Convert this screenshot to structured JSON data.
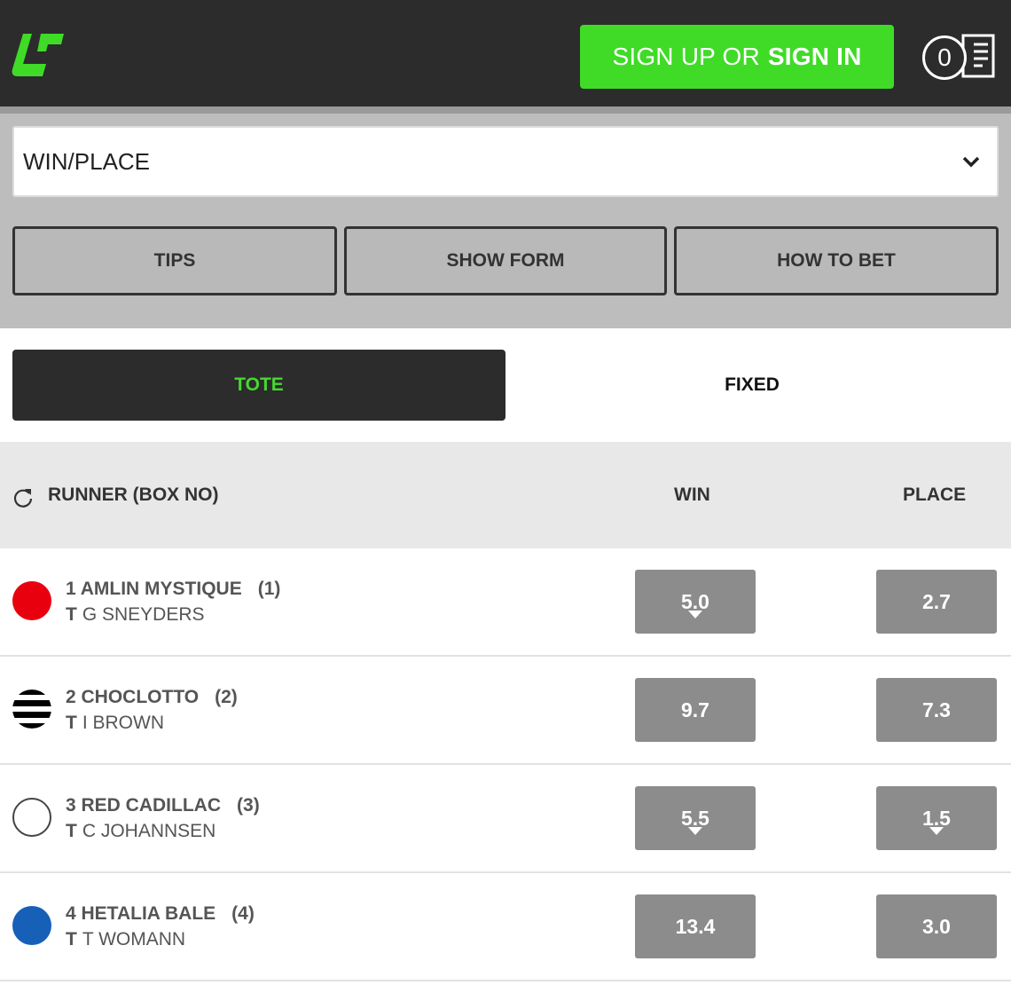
{
  "header": {
    "signin_label_regular": "SIGN UP OR",
    "signin_label_bold": "SIGN IN",
    "betslip_count": "0",
    "logo_icon": "ub-logo-icon",
    "betslip_icon": "betslip-icon",
    "brand_color": "#3fdb27"
  },
  "bet_type": {
    "selected": "WIN/PLACE",
    "icon": "chevron-down-icon"
  },
  "action_tabs": [
    "TIPS",
    "SHOW FORM",
    "HOW TO BET"
  ],
  "price_type": {
    "options": [
      "TOTE",
      "FIXED"
    ],
    "active": "TOTE"
  },
  "table": {
    "refresh_icon": "refresh-icon",
    "headers": {
      "runner": "RUNNER (BOX NO)",
      "win": "WIN",
      "place": "PLACE"
    },
    "runners": [
      {
        "name": "1 AMLIN MYSTIQUE",
        "box": "(1)",
        "trainer_prefix": "T",
        "trainer": "G SNEYDERS",
        "silk": "red-circle",
        "silk_color": "#e8000f",
        "win": "5.0",
        "win_drift": "down",
        "place": "2.7",
        "place_drift": ""
      },
      {
        "name": "2 CHOCLOTTO",
        "box": "(2)",
        "trainer_prefix": "T",
        "trainer": "I BROWN",
        "silk": "black-white-striped-circle",
        "silk_color": "#000000",
        "win": "9.7",
        "win_drift": "",
        "place": "7.3",
        "place_drift": ""
      },
      {
        "name": "3 RED CADILLAC",
        "box": "(3)",
        "trainer_prefix": "T",
        "trainer": "C JOHANNSEN",
        "silk": "white-circle",
        "silk_color": "#ffffff",
        "win": "5.5",
        "win_drift": "down",
        "place": "1.5",
        "place_drift": "down"
      },
      {
        "name": "4 HETALIA BALE",
        "box": "(4)",
        "trainer_prefix": "T",
        "trainer": "T WOMANN",
        "silk": "blue-circle",
        "silk_color": "#1760b8",
        "win": "13.4",
        "win_drift": "",
        "place": "3.0",
        "place_drift": ""
      }
    ]
  }
}
